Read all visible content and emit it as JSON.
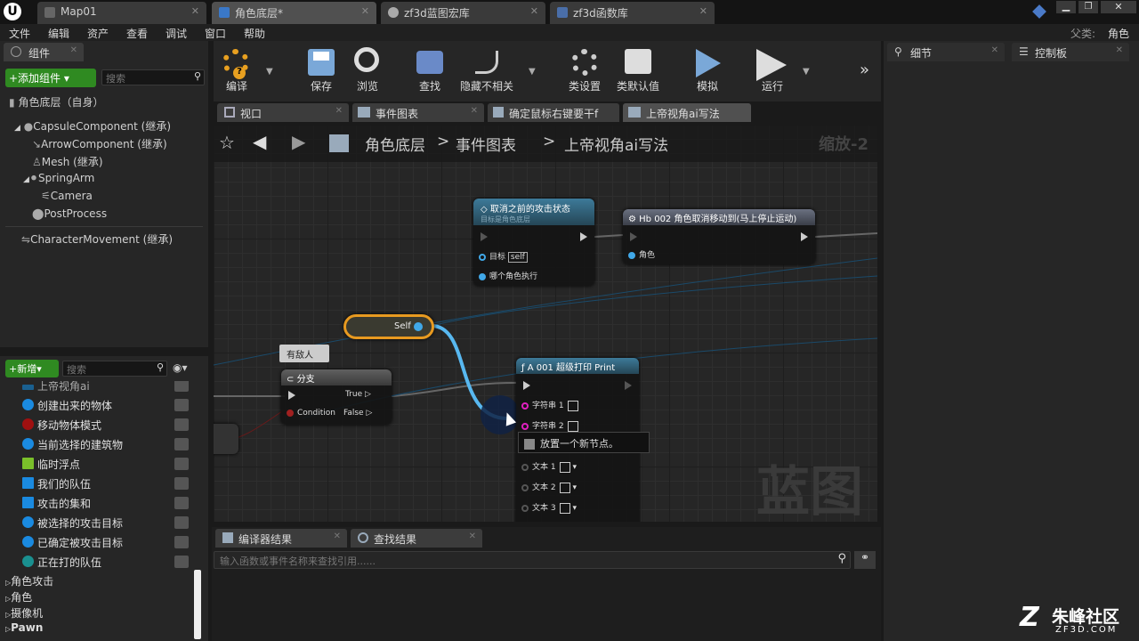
{
  "window": {
    "tabs": [
      {
        "label": "Map01"
      },
      {
        "label": "角色底层*"
      },
      {
        "label": "zf3d蓝图宏库"
      },
      {
        "label": "zf3d函数库"
      }
    ],
    "parent_class_label": "父类:",
    "parent_class_value": "角色"
  },
  "menu": [
    "文件",
    "编辑",
    "资产",
    "查看",
    "调试",
    "窗口",
    "帮助"
  ],
  "components_panel": {
    "tab": "组件",
    "add_button": "+添加组件",
    "search_placeholder": "搜索",
    "root": "角色底层（自身）",
    "items": [
      "CapsuleComponent (继承)",
      "ArrowComponent (继承)",
      "Mesh (继承)",
      "SpringArm",
      "Camera",
      "PostProcess",
      "CharacterMovement (继承)"
    ]
  },
  "mybp_panel": {
    "new_button": "+新增",
    "search_placeholder": "搜索",
    "partial_item": "上帝视角ai",
    "variables": [
      {
        "label": "创建出来的物体",
        "color": "#1a8ae0"
      },
      {
        "label": "移动物体模式",
        "color": "#a01010"
      },
      {
        "label": "当前选择的建筑物",
        "color": "#1a8ae0"
      },
      {
        "label": "临时浮点",
        "color": "#7ac02a"
      },
      {
        "label": "我们的队伍",
        "color": "#1a8ae0"
      },
      {
        "label": "攻击的集和",
        "color": "#1a8ae0"
      },
      {
        "label": "被选择的攻击目标",
        "color": "#1a8ae0"
      },
      {
        "label": "已确定被攻击目标",
        "color": "#1a8ae0"
      },
      {
        "label": "正在打的队伍",
        "color": "#1a9090"
      }
    ],
    "categories": [
      "角色攻击",
      "角色",
      "摄像机",
      "Pawn"
    ]
  },
  "toolbar": {
    "buttons": [
      "编译",
      "保存",
      "浏览",
      "查找",
      "隐藏不相关",
      "类设置",
      "类默认值",
      "模拟",
      "运行"
    ]
  },
  "editor_tabs": [
    "视口",
    "事件图表",
    "确定鼠标右键要干f",
    "上帝视角ai写法"
  ],
  "breadcrumb": {
    "items": [
      "角色底层",
      "事件图表",
      "上帝视角ai写法"
    ],
    "zoom": "缩放-2"
  },
  "graph": {
    "watermark": "蓝图",
    "node_cancel_attack": {
      "title": "取消之前的攻击状态",
      "subtitle": "目标是角色底层",
      "pin_target": "目标",
      "pin_target_value": "self",
      "pin_role": "哪个角色执行"
    },
    "node_hb002": {
      "title": "Hb 002 角色取消移动到(马上停止运动)",
      "pin_role": "角色"
    },
    "node_self": {
      "label": "Self"
    },
    "comment": "有敌人",
    "node_branch": {
      "title": "分支",
      "pin_condition": "Condition",
      "pin_true": "True",
      "pin_false": "False"
    },
    "node_print": {
      "title": "A 001 超级打印 Print",
      "pins": [
        "字符串 1",
        "字符串 2",
        "文本 1",
        "文本 2",
        "文本 3"
      ]
    },
    "tooltip": "放置一个新节点。"
  },
  "bottom_tabs": [
    "编译器结果",
    "查找结果"
  ],
  "find_placeholder": "输入函数或事件名称来查找引用......",
  "details_panel": {
    "tab_details": "细节",
    "tab_console": "控制板"
  },
  "watermark_site": {
    "name": "朱峰社区",
    "url": "ZF3D.COM"
  }
}
